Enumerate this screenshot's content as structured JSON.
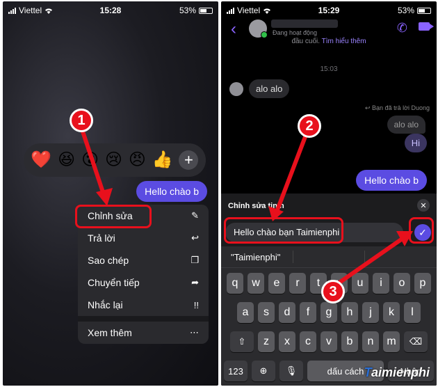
{
  "left": {
    "status": {
      "carrier": "Viettel",
      "time": "15:28",
      "battery": "53%"
    },
    "reactions": [
      "❤️",
      "😆",
      "😮",
      "😢",
      "😠",
      "👍"
    ],
    "reaction_add": "+",
    "message": "Hello chào b",
    "menu": [
      {
        "label": "Chỉnh sửa",
        "icon": "pencil-icon",
        "glyph": "✎"
      },
      {
        "label": "Trả lời",
        "icon": "reply-icon",
        "glyph": "↩"
      },
      {
        "label": "Sao chép",
        "icon": "copy-icon",
        "glyph": "❐"
      },
      {
        "label": "Chuyển tiếp",
        "icon": "forward-icon",
        "glyph": "➦"
      },
      {
        "label": "Nhắc lại",
        "icon": "remind-icon",
        "glyph": "!!"
      }
    ],
    "more": {
      "label": "Xem thêm",
      "glyph": "⋯"
    }
  },
  "right": {
    "status": {
      "carrier": "Viettel",
      "time": "15:29",
      "battery": "53%"
    },
    "header_status": "Đang hoạt động",
    "notice_text": "đầu cuối.",
    "notice_link": "Tìm hiểu thêm",
    "timestamp": "15:03",
    "incoming": "alo alo",
    "reply_note": "Bạn đã trả lời Duong",
    "quoted": "alo alo",
    "hi": "Hi",
    "sent": "Hello chào b",
    "edit_title": "Chỉnh sửa tin n",
    "edit_value": "Hello chào bạn Taimienphi",
    "suggestion": "\"Taimienphi\"",
    "keys_row1": [
      "q",
      "w",
      "e",
      "r",
      "t",
      "y",
      "u",
      "i",
      "o",
      "p"
    ],
    "keys_row2": [
      "a",
      "s",
      "d",
      "f",
      "g",
      "h",
      "j",
      "k",
      "l"
    ],
    "keys_row3": [
      "z",
      "x",
      "c",
      "v",
      "b",
      "n",
      "m"
    ],
    "key_123": "123",
    "key_space": "dấu cách",
    "key_return": "Nhập",
    "watermark": "aimienphi",
    "watermark_t": "T"
  },
  "steps": [
    "1",
    "2",
    "3"
  ],
  "colors": {
    "accent": "#5b4ce2",
    "annotation": "#e8101c"
  }
}
